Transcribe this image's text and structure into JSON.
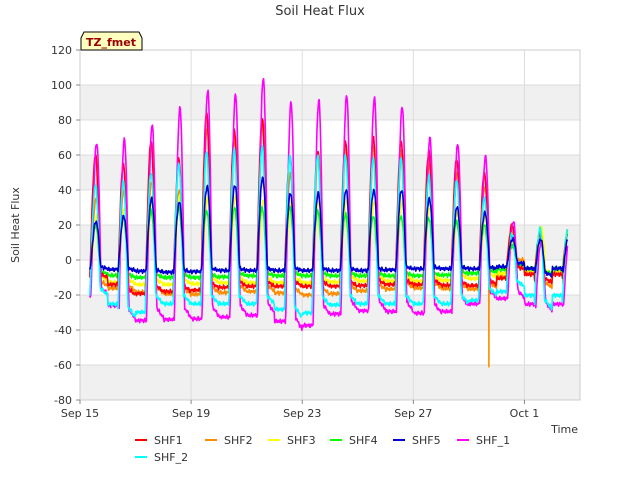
{
  "chart_data": {
    "type": "line",
    "title": "Soil Heat Flux",
    "xlabel": "Time",
    "ylabel": "Soil Heat Flux",
    "badge": "TZ_fmet",
    "ylim": [
      -80,
      120
    ],
    "xlim_days": [
      0,
      18
    ],
    "yticks": [
      -80,
      -60,
      -40,
      -20,
      0,
      20,
      40,
      60,
      80,
      100,
      120
    ],
    "xticks": [
      {
        "day": 0,
        "label": "Sep 15"
      },
      {
        "day": 4,
        "label": "Sep 19"
      },
      {
        "day": 8,
        "label": "Sep 23"
      },
      {
        "day": 12,
        "label": "Sep 27"
      },
      {
        "day": 16,
        "label": "Oct 1"
      }
    ],
    "grid": true,
    "legend_position": "bottom",
    "x_start_day": 0.35,
    "x_end_day": 17.55,
    "series": [
      {
        "name": "SHF1",
        "color": "#ff0000",
        "peak": [
          60,
          55,
          68,
          58,
          84,
          74,
          80,
          60,
          62,
          68,
          70,
          68,
          62,
          58,
          50,
          20,
          15
        ],
        "trough": [
          -10,
          -20,
          -18,
          -18,
          -16,
          -15,
          -15,
          -15,
          -15,
          -15,
          -14,
          -14,
          -14,
          -15,
          -14,
          -5,
          -13
        ]
      },
      {
        "name": "SHF2",
        "color": "#ff8c00",
        "peak": [
          35,
          40,
          45,
          40,
          75,
          70,
          80,
          50,
          62,
          66,
          66,
          62,
          55,
          50,
          42,
          15,
          18
        ],
        "trough": [
          -15,
          -18,
          -19,
          -20,
          -19,
          -18,
          -18,
          -20,
          -20,
          -18,
          -17,
          -16,
          -16,
          -17,
          -16,
          0,
          -16
        ]
      },
      {
        "name": "SHF3",
        "color": "#ffff00",
        "peak": [
          25,
          30,
          33,
          38,
          35,
          36,
          34,
          33,
          33,
          34,
          33,
          33,
          30,
          28,
          25,
          10,
          19
        ],
        "trough": [
          -12,
          -14,
          -14,
          -14,
          -13,
          -13,
          -13,
          -13,
          -13,
          -12,
          -12,
          -12,
          -12,
          -11,
          -10,
          -4,
          -8
        ]
      },
      {
        "name": "SHF4",
        "color": "#00ff00",
        "peak": [
          20,
          25,
          28,
          30,
          28,
          30,
          30,
          30,
          28,
          26,
          25,
          25,
          24,
          22,
          20,
          8,
          15
        ],
        "trough": [
          -8,
          -10,
          -10,
          -10,
          -10,
          -9,
          -9,
          -9,
          -9,
          -9,
          -9,
          -9,
          -9,
          -8,
          -7,
          -3,
          -8
        ]
      },
      {
        "name": "SHF5",
        "color": "#0000cc",
        "peak": [
          22,
          25,
          35,
          33,
          42,
          43,
          47,
          38,
          38,
          40,
          40,
          40,
          35,
          30,
          27,
          12,
          12
        ],
        "trough": [
          -5,
          -6,
          -7,
          -7,
          -6,
          -6,
          -6,
          -6,
          -6,
          -6,
          -6,
          -5,
          -5,
          -5,
          -5,
          -2,
          -9
        ]
      },
      {
        "name": "SHF_1",
        "color": "#ff00ff",
        "peak": [
          67,
          69,
          77,
          87,
          97,
          95,
          104,
          90,
          91,
          94,
          93,
          88,
          70,
          66,
          59,
          22,
          10
        ],
        "trough": [
          -20,
          -35,
          -34,
          -34,
          -33,
          -32,
          -31,
          -41,
          -32,
          -29,
          -29,
          -30,
          -31,
          -27,
          -22,
          -22,
          -30
        ]
      },
      {
        "name": "SHF_2",
        "color": "#00ffff",
        "peak": [
          43,
          45,
          50,
          55,
          62,
          63,
          65,
          60,
          60,
          60,
          58,
          58,
          48,
          46,
          36,
          15,
          18
        ],
        "trough": [
          -20,
          -33,
          -25,
          -25,
          -25,
          -25,
          -25,
          -33,
          -26,
          -25,
          -25,
          -25,
          -25,
          -25,
          -20,
          -15,
          -28
        ]
      }
    ],
    "anomalies": [
      {
        "series": "SHF2",
        "day": 14.72,
        "value": -61
      }
    ]
  }
}
